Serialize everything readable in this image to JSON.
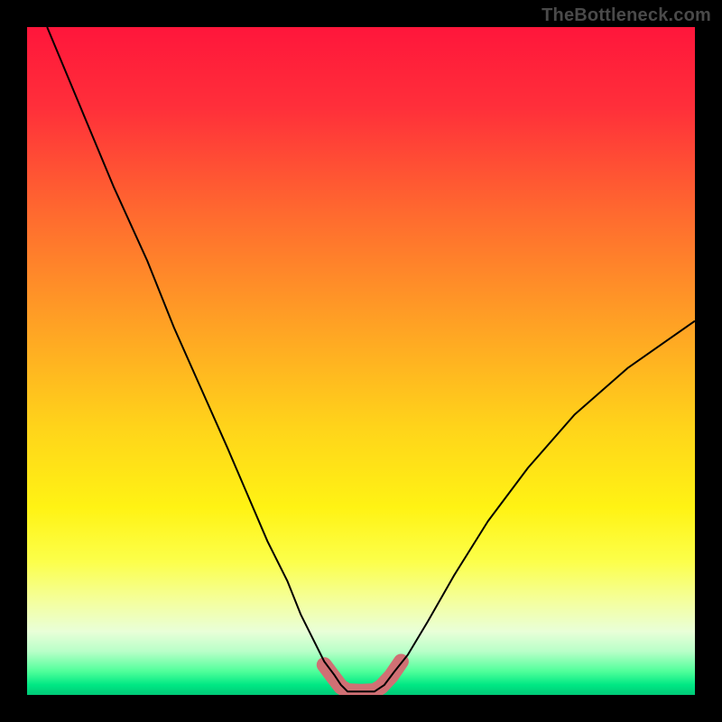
{
  "watermark": "TheBottleneck.com",
  "chart_data": {
    "type": "line",
    "title": "",
    "xlabel": "",
    "ylabel": "",
    "xlim": [
      0,
      100
    ],
    "ylim": [
      0,
      100
    ],
    "background_gradient": {
      "stops": [
        {
          "offset": 0.0,
          "color": "#ff163b"
        },
        {
          "offset": 0.12,
          "color": "#ff2f3a"
        },
        {
          "offset": 0.28,
          "color": "#ff6a2f"
        },
        {
          "offset": 0.45,
          "color": "#ffa324"
        },
        {
          "offset": 0.6,
          "color": "#ffd41a"
        },
        {
          "offset": 0.72,
          "color": "#fff314"
        },
        {
          "offset": 0.8,
          "color": "#fcff4a"
        },
        {
          "offset": 0.86,
          "color": "#f4ff9e"
        },
        {
          "offset": 0.905,
          "color": "#e9ffd8"
        },
        {
          "offset": 0.935,
          "color": "#b8ffc8"
        },
        {
          "offset": 0.965,
          "color": "#4fff9a"
        },
        {
          "offset": 0.985,
          "color": "#00e884"
        },
        {
          "offset": 1.0,
          "color": "#00c877"
        }
      ]
    },
    "series": [
      {
        "name": "bottleneck-curve",
        "color": "#000000",
        "width": 2,
        "x": [
          3,
          8,
          13,
          18,
          22,
          26,
          30,
          33,
          36,
          39,
          41,
          43,
          44.5,
          46,
          47,
          48,
          52,
          53.5,
          55,
          57,
          60,
          64,
          69,
          75,
          82,
          90,
          100
        ],
        "y": [
          100,
          88,
          76,
          65,
          55,
          46,
          37,
          30,
          23,
          17,
          12,
          8,
          5,
          3,
          1.5,
          0.5,
          0.5,
          1.5,
          3.5,
          6,
          11,
          18,
          26,
          34,
          42,
          49,
          56
        ]
      }
    ],
    "highlight": {
      "name": "optimal-zone",
      "color": "#d07074",
      "width": 17,
      "cap": "round",
      "x": [
        44.5,
        46,
        47,
        48,
        50,
        52,
        53,
        54.5,
        56
      ],
      "y": [
        4.5,
        2.5,
        1.2,
        0.6,
        0.5,
        0.6,
        1.2,
        2.8,
        5
      ]
    }
  }
}
